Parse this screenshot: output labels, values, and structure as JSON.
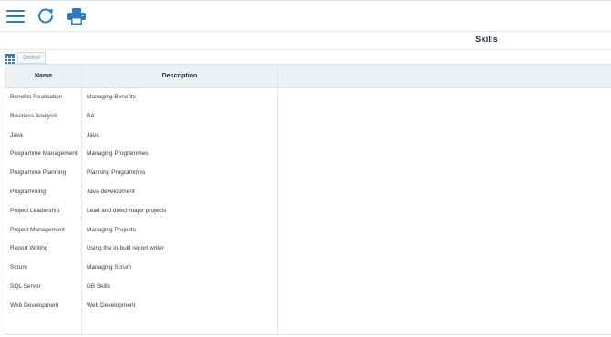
{
  "toolbar": {
    "icons": [
      "hamburger-menu-icon",
      "refresh-icon",
      "print-icon"
    ],
    "accent": "#2a7bbf"
  },
  "page": {
    "title": "Skills"
  },
  "actions": {
    "delete_label": "Delete"
  },
  "table": {
    "columns": [
      "Name",
      "Description"
    ],
    "rows": [
      {
        "name": "Benefits Realisation",
        "description": "Managing Benefits"
      },
      {
        "name": "Business Analysis",
        "description": "BA"
      },
      {
        "name": "Java",
        "description": "Java"
      },
      {
        "name": "Programme Management",
        "description": "Managing Programmes"
      },
      {
        "name": "Programme Planning",
        "description": "Planning Programmes"
      },
      {
        "name": "Programming",
        "description": "Java development"
      },
      {
        "name": "Project Leadership",
        "description": "Lead and direct major projects"
      },
      {
        "name": "Project Management",
        "description": "Managing Projects"
      },
      {
        "name": "Report Writing",
        "description": "Using the in-built report writer"
      },
      {
        "name": "Scrum",
        "description": "Managing Scrum"
      },
      {
        "name": "SQL Server",
        "description": "DB Skills"
      },
      {
        "name": "Web Development",
        "description": "Web Development"
      }
    ]
  }
}
